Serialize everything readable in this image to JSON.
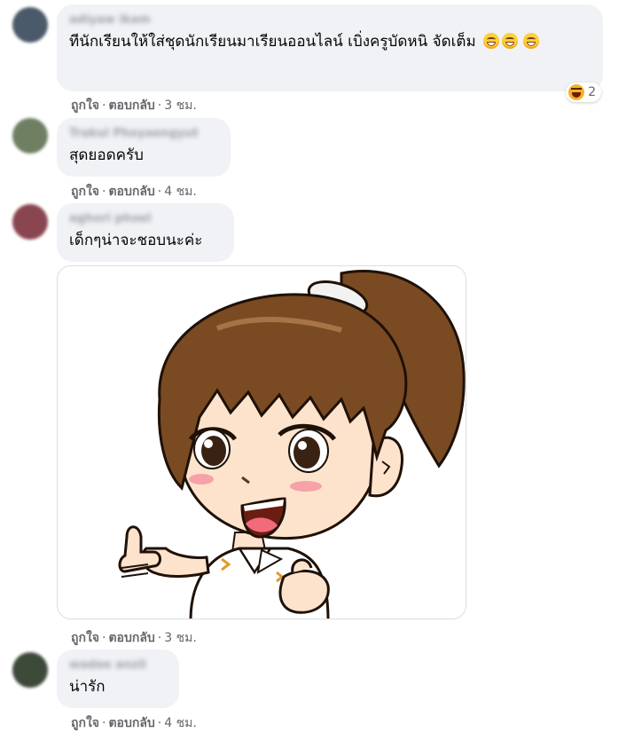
{
  "comments": [
    {
      "author": "adiyaw ikam",
      "text": "ทีนักเรียนให้ใส่ชุดนักเรียนมาเรียนออนไลน์ เบิ่งครูบัดหนิ จัดเต็ม",
      "like_label": "ถูกใจ",
      "reply_label": "ตอบกลับ",
      "time": "3 ชม.",
      "reaction_count": "2",
      "avatar_color": "#4b5a6a"
    },
    {
      "author": "Trakul Phoyaengyut",
      "text": "สุดยอดครับ",
      "like_label": "ถูกใจ",
      "reply_label": "ตอบกลับ",
      "time": "4 ชม.",
      "avatar_color": "#6f7f62"
    },
    {
      "author": "aghori phoel",
      "text": "เด็กๆน่าจะชอบนะค่ะ",
      "like_label": "ถูกใจ",
      "reply_label": "ตอบกลับ",
      "time": "3 ชม.",
      "avatar_color": "#8a4650",
      "attachment": "sticker-girl-thumbs-up"
    },
    {
      "author": "wadee anzil",
      "text": "น่ารัก",
      "like_label": "ถูกใจ",
      "reply_label": "ตอบกลับ",
      "time": "4 ชม.",
      "avatar_color": "#3d4a3a"
    }
  ],
  "separator": "·",
  "colors": {
    "bubble_bg": "#f0f2f5",
    "meta_text": "#65676b",
    "hair": "#7a4a22",
    "skin": "#fde3cc"
  }
}
